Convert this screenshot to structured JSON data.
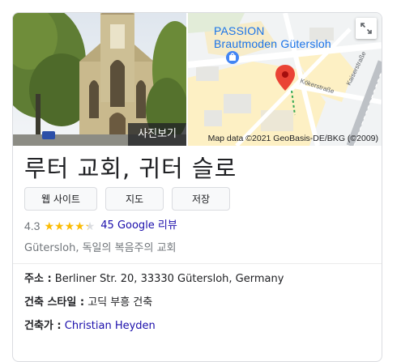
{
  "photo": {
    "badge_label": "사진보기"
  },
  "map": {
    "business_line1": "PASSION",
    "business_line2": "Brautmoden Gütersloh",
    "street1": "Kökerstraße",
    "street2": "Kaiserstraße",
    "attribution": "Map data ©2021 GeoBasis-DE/BKG (©2009)",
    "marker_color": "#ea4335"
  },
  "place": {
    "title": "루터 교회, 귀터 슬로",
    "rating": "4.3",
    "rating_value": 4.3,
    "reviews_link": "45 Google 리뷰",
    "category": "Gütersloh, 독일의 복음주의 교회"
  },
  "actions": {
    "website": "웹 사이트",
    "directions": "지도",
    "save": "저장"
  },
  "info": {
    "address_label": "주소 :",
    "address_value": "Berliner Str. 20, 33330 Gütersloh, Germany",
    "style_label": "건축 스타일 :",
    "style_value": "고딕 부흥 건축",
    "architect_label": "건축가 :",
    "architect_value": "Christian Heyden"
  },
  "colors": {
    "link": "#1a0dab",
    "star": "#fbbc04",
    "map_link": "#1a73e8"
  }
}
